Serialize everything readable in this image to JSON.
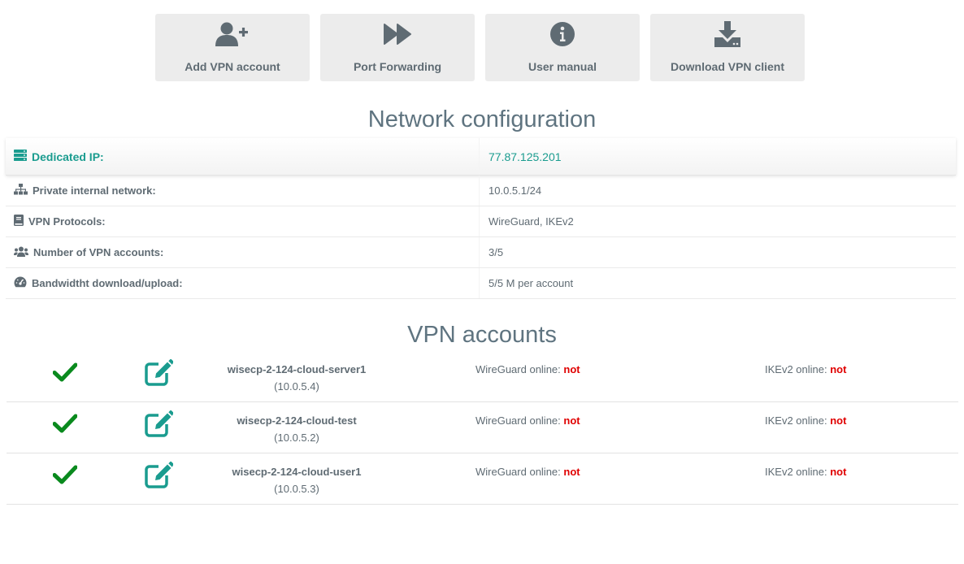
{
  "actions": [
    {
      "label": "Add VPN account",
      "icon": "add-user-icon"
    },
    {
      "label": "Port Forwarding",
      "icon": "fast-forward-icon"
    },
    {
      "label": "User manual",
      "icon": "info-icon"
    },
    {
      "label": "Download VPN client",
      "icon": "download-icon"
    }
  ],
  "network": {
    "title": "Network configuration",
    "rows": [
      {
        "label": "Dedicated IP:",
        "value": "77.87.125.201",
        "icon": "server-icon"
      },
      {
        "label": "Private internal network:",
        "value": "10.0.5.1/24",
        "icon": "sitemap-icon"
      },
      {
        "label": "VPN Protocols:",
        "value": "WireGuard, IKEv2",
        "icon": "book-icon"
      },
      {
        "label": "Number of VPN accounts:",
        "value": "3/5",
        "icon": "users-icon"
      },
      {
        "label": "Bandwidtht download/upload:",
        "value": "5/5 M per account",
        "icon": "gauge-icon"
      }
    ]
  },
  "accounts": {
    "title": "VPN accounts",
    "wg_label": "WireGuard online: ",
    "ike_label": "IKEv2 online: ",
    "items": [
      {
        "name": "wisecp-2-124-cloud-server1",
        "ip": "(10.0.5.4)",
        "wg_status": "not",
        "ike_status": "not"
      },
      {
        "name": "wisecp-2-124-cloud-test",
        "ip": "(10.0.5.2)",
        "wg_status": "not",
        "ike_status": "not"
      },
      {
        "name": "wisecp-2-124-cloud-user1",
        "ip": "(10.0.5.3)",
        "wg_status": "not",
        "ike_status": "not"
      }
    ]
  },
  "colors": {
    "accent": "#1a9c8f",
    "check": "#0a8a1e",
    "status_bad": "#e00000",
    "button_bg": "#ececec"
  }
}
